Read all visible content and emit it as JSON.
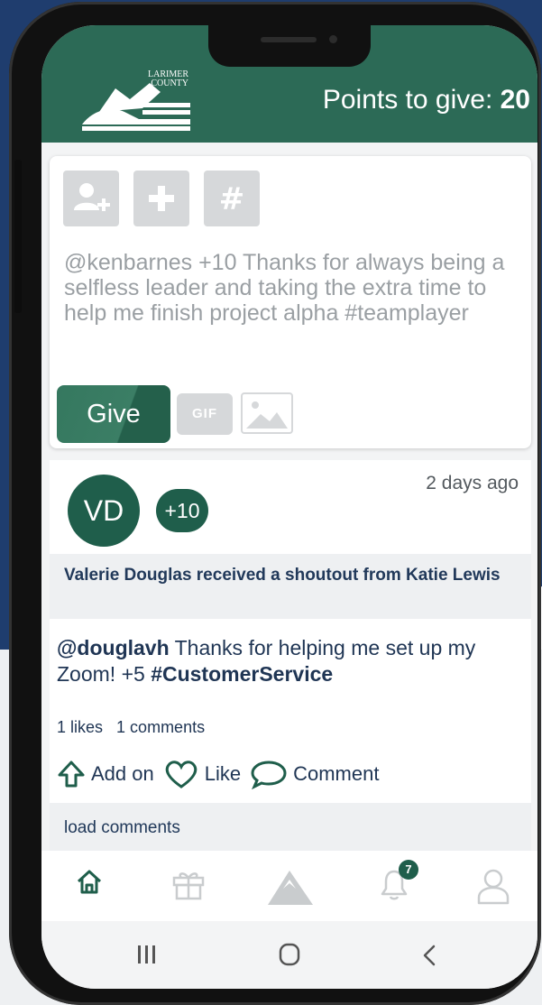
{
  "header": {
    "logo_text_line1": "LARIMER",
    "logo_text_line2": "COUNTY",
    "points_label": "Points to give: ",
    "points_value": "20"
  },
  "compose": {
    "tools": [
      "add-user-icon",
      "plus-icon",
      "hashtag-icon"
    ],
    "message": "@kenbarnes +10 Thanks for always being a selfless leader and taking the extra time to help me finish project alpha #teamplayer",
    "give_label": "Give",
    "gif_label": "GIF",
    "image_icon": "image-icon"
  },
  "post": {
    "avatar_initials": "VD",
    "points": "+10",
    "time": "2 days ago",
    "banner": "Valerie Douglas received a shoutout from Katie Lewis",
    "mention": "@douglavh",
    "body_text": " Thanks for helping me set up my Zoom! +5 ",
    "hashtag": "#CustomerService",
    "likes": "1 likes",
    "comments": "1 comments",
    "actions": {
      "add_on": "Add on",
      "like": "Like",
      "comment": "Comment"
    },
    "load_comments": "load comments"
  },
  "tabbar": {
    "items": [
      "home-icon",
      "gift-icon",
      "mountain-icon",
      "bell-icon",
      "profile-icon"
    ],
    "notification_count": "7"
  },
  "colors": {
    "brand_green": "#2c6a56",
    "dark_green": "#1f5e4b",
    "text_navy": "#1f3554",
    "navy_bg": "#1f3d6e"
  }
}
